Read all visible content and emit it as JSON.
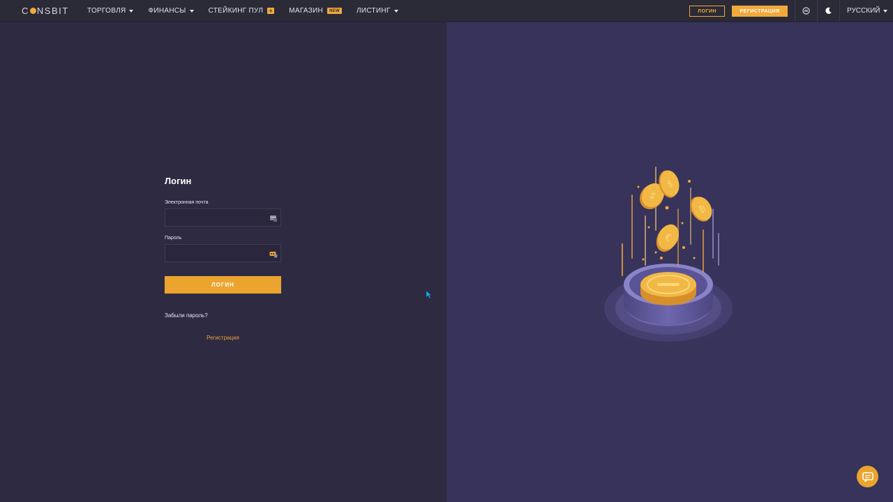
{
  "brand": {
    "name_prefix": "C",
    "name_suffix": "NSBIT",
    "accent_color": "#f0a93a"
  },
  "nav": {
    "items": [
      {
        "label": "ТОРГОВЛЯ",
        "has_caret": true
      },
      {
        "label": "ФИНАНСЫ",
        "has_caret": true
      },
      {
        "label": "СТЕЙКИНГ ПУЛ",
        "badge": "+"
      },
      {
        "label": "МАГАЗИН",
        "badge": "NEW"
      },
      {
        "label": "ЛИСТИНГ",
        "has_caret": true
      }
    ],
    "login_label": "ЛОГИН",
    "register_label": "РЕГИСТРАЦИЯ",
    "language": "РУССКИЙ",
    "icons": [
      "coinmarketcap-icon",
      "moon-icon"
    ]
  },
  "login_form": {
    "title": "Логин",
    "email_label": "Электронная почта",
    "email_value": "",
    "password_label": "Пароль",
    "password_value": "",
    "submit_label": "ЛОГИН",
    "forgot_label": "Забыли пароль?",
    "register_label": "Регистрация"
  },
  "chat": {
    "icon": "chat-icon"
  }
}
